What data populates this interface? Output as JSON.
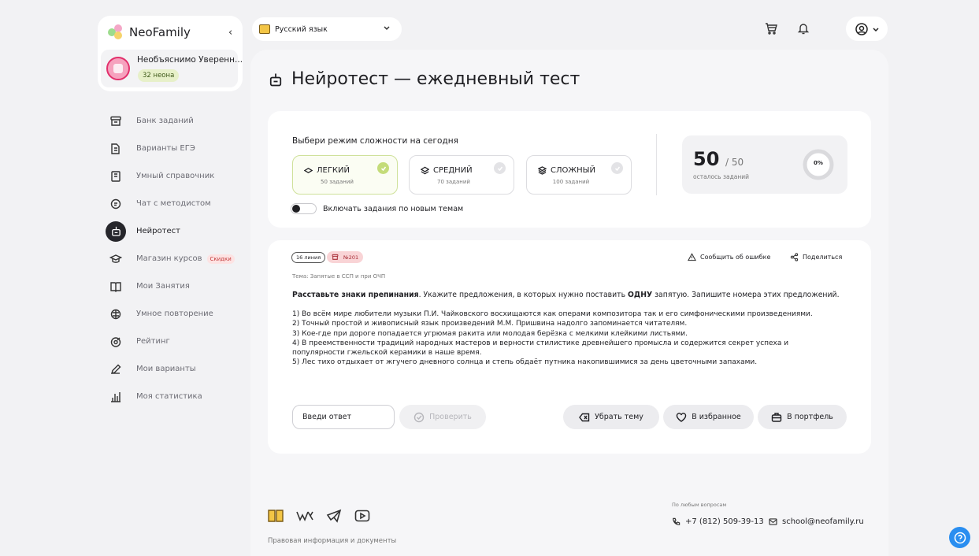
{
  "brand": {
    "name": "NeoFamily"
  },
  "user": {
    "name": "Необъяснимо Уверенн...",
    "neon_badge": "32 неона"
  },
  "nav": {
    "items": [
      {
        "label": "Банк заданий",
        "icon": "archive-icon"
      },
      {
        "label": "Варианты ЕГЭ",
        "icon": "documents-icon"
      },
      {
        "label": "Умный справочник",
        "icon": "reference-book-icon"
      },
      {
        "label": "Чат с методистом",
        "icon": "chat-icon"
      },
      {
        "label": "Нейротест",
        "icon": "robot-icon",
        "active": true
      },
      {
        "label": "Магазин курсов",
        "icon": "graduation-cap-icon",
        "badge": "Скидки"
      },
      {
        "label": "Мои Занятия",
        "icon": "open-book-icon"
      },
      {
        "label": "Умное повторение",
        "icon": "brain-icon"
      },
      {
        "label": "Рейтинг",
        "icon": "target-icon"
      },
      {
        "label": "Мои варианты",
        "icon": "pencil-icon"
      },
      {
        "label": "Моя статистика",
        "icon": "bar-chart-icon"
      }
    ]
  },
  "topbar": {
    "subject": "Русский язык"
  },
  "page": {
    "title": "Нейротест — ежедневный тест"
  },
  "mode": {
    "prompt": "Выбери режим сложности на сегодня",
    "options": [
      {
        "label": "ЛЕГКИЙ",
        "sub": "50 заданий",
        "selected": true
      },
      {
        "label": "СРЕДНИЙ",
        "sub": "70 заданий",
        "selected": false
      },
      {
        "label": "СЛОЖНЫЙ",
        "sub": "100 заданий",
        "selected": false
      }
    ],
    "toggle_label": "Включать задания по новым темам",
    "toggle_on": false
  },
  "remaining": {
    "count": "50",
    "total": "/ 50",
    "label": "осталось заданий",
    "percent_text": "0%",
    "progress": 0
  },
  "task": {
    "line": "16 линия",
    "number": "№201",
    "report": "Сообщить об ошибке",
    "share": "Поделиться",
    "topic": "Тема: Запятые в ССП и при ОЧП",
    "instruction_bold": "Расставьте знаки препинания",
    "instruction_mid": ". Укажите предложения, в которых нужно поставить ",
    "instruction_bold2": "ОДНУ",
    "instruction_end": " запятую. Запишите номера этих предложений.",
    "sentences": [
      "1) Во всём мире любители музыки П.И. Чайковского восхищаются как операми композитора так и его симфоническими произведениями.",
      "2) Точный простой и живописный язык произведений М.М. Пришвина надолго запоминается читателям.",
      "3) Кое-где при дороге попадается угрюмая ракита или молодая берёзка с мелкими клейкими листьями.",
      "4) В преемственности традиций народных мастеров и верности стилистике древнейшего промысла и содержится секрет успеха и популярности гжельской керамики в наше время.",
      "5) Лес тихо отдыхает от жгучего дневного солнца и степь обдаёт путника накопившимися за день цветочными запахами."
    ],
    "answer_placeholder": "Введи ответ",
    "check": "Проверить",
    "remove_topic": "Убрать тему",
    "favorite": "В избранное",
    "portfolio": "В портфель"
  },
  "footer": {
    "legal": "Правовая информация и документы",
    "any_question": "По любым вопросам",
    "phone": "+7 (812) 509-39-13",
    "email": "school@neofamily.ru"
  },
  "colors": {
    "accent_green": "#c4dc79",
    "tag_red": "#f9d4d6",
    "help_blue": "#2a8ef0"
  }
}
